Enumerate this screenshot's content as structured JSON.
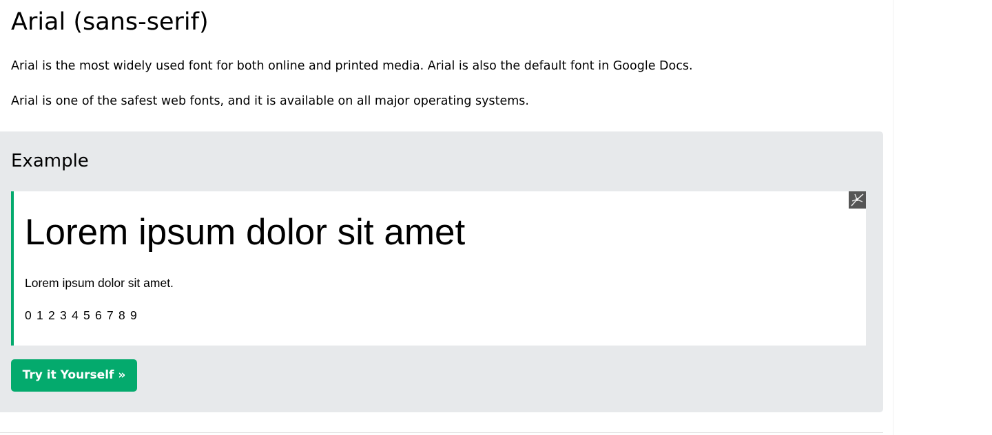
{
  "article": {
    "title": "Arial (sans-serif)",
    "paragraphs": [
      "Arial is the most widely used font for both online and printed media. Arial is also the default font in Google Docs.",
      "Arial is one of the safest web fonts, and it is available on all major operating systems."
    ]
  },
  "example": {
    "heading": "Example",
    "demo_heading": "Lorem ipsum dolor sit amet",
    "demo_text": "Lorem ipsum dolor sit amet.",
    "demo_digits": "0 1 2 3 4 5 6 7 8 9",
    "corner_icon": "broken-image-icon",
    "button_label": "Try it Yourself »"
  },
  "colors": {
    "accent": "#04aa6d",
    "panel_bg": "#e7e9eb",
    "button_text": "#ffffff"
  }
}
